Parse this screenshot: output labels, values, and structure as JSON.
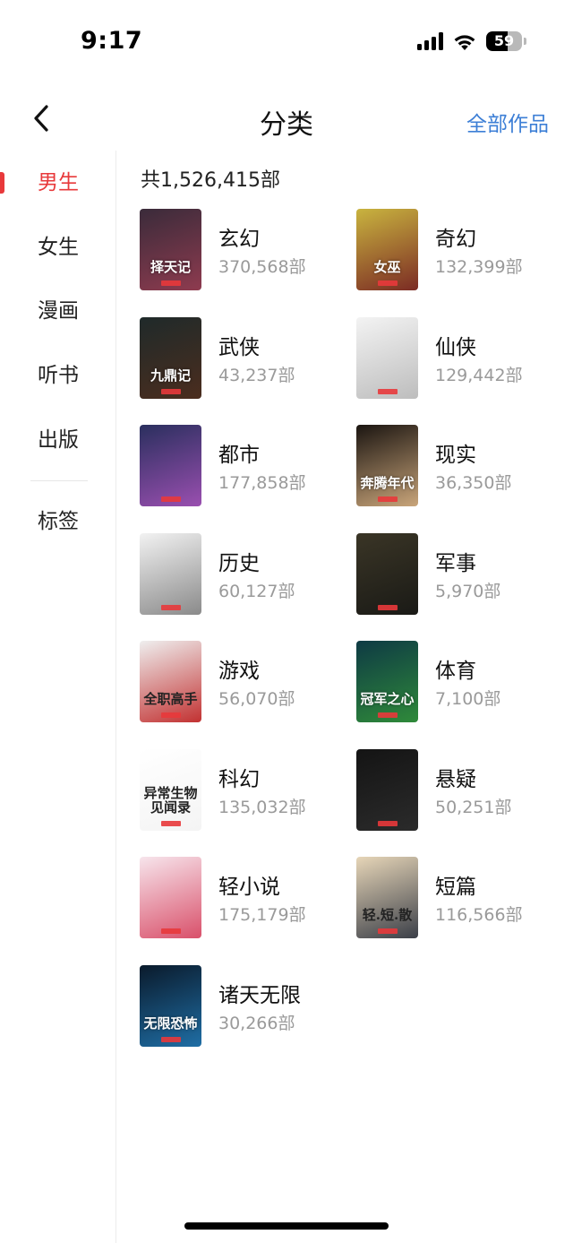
{
  "status": {
    "time": "9:17",
    "battery": "59",
    "battery_level": 0.59
  },
  "nav": {
    "title": "分类",
    "action": "全部作品"
  },
  "sidebar": {
    "items": [
      {
        "label": "男生",
        "active": true
      },
      {
        "label": "女生",
        "active": false
      },
      {
        "label": "漫画",
        "active": false
      },
      {
        "label": "听书",
        "active": false
      },
      {
        "label": "出版",
        "active": false
      }
    ],
    "extra": {
      "label": "标签"
    }
  },
  "main": {
    "total": "共1,526,415部",
    "categories": [
      {
        "name": "玄幻",
        "count": "370,568部",
        "cover_text": "择天记",
        "colors": [
          "#3a2b3a",
          "#8e3b4f"
        ]
      },
      {
        "name": "奇幻",
        "count": "132,399部",
        "cover_text": "女巫",
        "colors": [
          "#c9b43f",
          "#7b2b24"
        ]
      },
      {
        "name": "武侠",
        "count": "43,237部",
        "cover_text": "九鼎记",
        "colors": [
          "#1f2a2a",
          "#4b2d1e"
        ]
      },
      {
        "name": "仙侠",
        "count": "129,442部",
        "cover_text": "",
        "colors": [
          "#f3f3f3",
          "#bdbdbd"
        ]
      },
      {
        "name": "都市",
        "count": "177,858部",
        "cover_text": "",
        "colors": [
          "#2a2f5e",
          "#9a4fb0"
        ]
      },
      {
        "name": "现实",
        "count": "36,350部",
        "cover_text": "奔腾年代",
        "colors": [
          "#1b1511",
          "#c9a57a"
        ]
      },
      {
        "name": "历史",
        "count": "60,127部",
        "cover_text": "",
        "colors": [
          "#f2f2f2",
          "#8a8a8a"
        ]
      },
      {
        "name": "军事",
        "count": "5,970部",
        "cover_text": "",
        "colors": [
          "#3a3526",
          "#1a1a16"
        ]
      },
      {
        "name": "游戏",
        "count": "56,070部",
        "cover_text": "全职高手",
        "colors": [
          "#efefef",
          "#c23131"
        ]
      },
      {
        "name": "体育",
        "count": "7,100部",
        "cover_text": "冠军之心",
        "colors": [
          "#0e3a44",
          "#2f8a3a"
        ]
      },
      {
        "name": "科幻",
        "count": "135,032部",
        "cover_text": "异常生物见闻录",
        "colors": [
          "#ffffff",
          "#f4f4f4"
        ]
      },
      {
        "name": "悬疑",
        "count": "50,251部",
        "cover_text": "",
        "colors": [
          "#141414",
          "#2b2b2b"
        ]
      },
      {
        "name": "轻小说",
        "count": "175,179部",
        "cover_text": "",
        "colors": [
          "#f7e5ec",
          "#d9506a"
        ]
      },
      {
        "name": "短篇",
        "count": "116,566部",
        "cover_text": "轻.短.散",
        "colors": [
          "#e7d6b8",
          "#3b3f48"
        ]
      },
      {
        "name": "诸天无限",
        "count": "30,266部",
        "cover_text": "无限恐怖",
        "colors": [
          "#0a1a2b",
          "#1f6ea5"
        ]
      }
    ]
  },
  "colors": {
    "accent": "#e8393b",
    "link": "#3d7fd6",
    "muted": "#9a9a9a"
  }
}
